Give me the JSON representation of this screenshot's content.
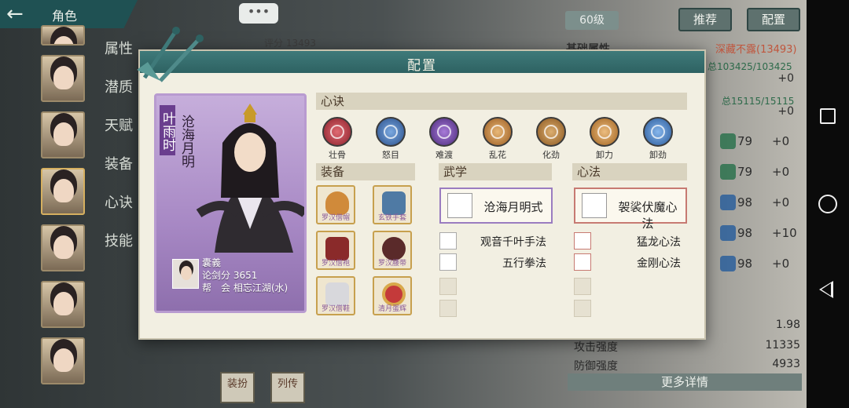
{
  "header": {
    "title": "角色",
    "back_icon": "back-arrow-icon"
  },
  "side_menu": [
    "属性",
    "潜质",
    "天赋",
    "装备",
    "心诀",
    "技能"
  ],
  "chat_icon": "chat-bubble-icon",
  "background": {
    "score": "评分 13493",
    "level": "60级",
    "recommend_button": "推荐",
    "config_button": "配置",
    "base_attr_heading": "基础属性",
    "hidden_text": "深藏不露(13493)",
    "total_hp": "总103425/103425",
    "hp_plus": "+0",
    "total_mp": "总15115/15115",
    "mp_plus": "+0",
    "attr_rows": [
      {
        "num": "79",
        "plus": "+0"
      },
      {
        "num": "79",
        "plus": "+0"
      },
      {
        "num": "98",
        "plus": "+0"
      },
      {
        "num": "98",
        "plus": "+10"
      },
      {
        "num": "98",
        "plus": "+0"
      }
    ],
    "stats": [
      {
        "label": "",
        "value": "1.98"
      },
      {
        "label": "攻击强度",
        "value": "11335"
      },
      {
        "label": "防御强度",
        "value": "4933"
      }
    ],
    "more_details": "更多详情",
    "tab_outfit": "装扮",
    "tab_biography": "列传"
  },
  "modal": {
    "title": "配置",
    "character": {
      "name": "叶雨时",
      "title": "沧海月明",
      "player": "囊義",
      "sword_score": "论剑分 3651",
      "guild": "帮　会 相忘江湖(水)"
    },
    "xinjue_heading": "心诀",
    "skills": [
      {
        "label": "壮骨",
        "color": "#b0343c"
      },
      {
        "label": "怒目",
        "color": "#3f6fb4"
      },
      {
        "label": "难渡",
        "color": "#6a3f9c"
      },
      {
        "label": "乱花",
        "color": "#c0843a"
      },
      {
        "label": "化劲",
        "color": "#b87a34"
      },
      {
        "label": "卸力",
        "color": "#c38a3c"
      },
      {
        "label": "卸劲",
        "color": "#3f7ac4"
      }
    ],
    "equipment_heading": "装备",
    "equipment": [
      {
        "name": "罗汉僧帽",
        "color": "#d08a3a"
      },
      {
        "name": "玄铁手套",
        "color": "#4f7aa4"
      },
      {
        "name": "罗汉僧袍",
        "color": "#8a2a2a"
      },
      {
        "name": "罗汉腰带",
        "color": "#5a2a2a"
      },
      {
        "name": "罗汉僧鞋",
        "color": "#d8d8dc"
      },
      {
        "name": "清月蛋辉",
        "color": "#c43a3a"
      }
    ],
    "martial_heading": "武学",
    "martial_main": "沧海月明式",
    "martial_subs": [
      "观音千叶手法",
      "五行拳法"
    ],
    "mind_heading": "心法",
    "mind_main": "袈裟伏魔心法",
    "mind_subs": [
      "猛龙心法",
      "金刚心法"
    ]
  }
}
